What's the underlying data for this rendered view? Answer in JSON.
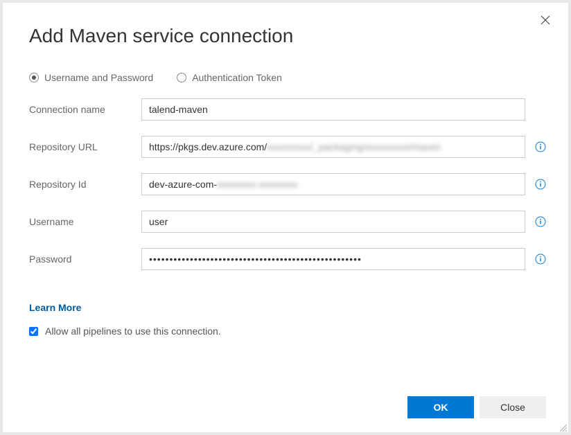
{
  "dialog": {
    "title": "Add Maven service connection",
    "close_tooltip": "Close"
  },
  "auth_method": {
    "options": [
      {
        "label": "Username and Password",
        "selected": true
      },
      {
        "label": "Authentication Token",
        "selected": false
      }
    ]
  },
  "fields": {
    "connection_name": {
      "label": "Connection name",
      "value": "talend-maven"
    },
    "repository_url": {
      "label": "Repository URL",
      "value": "https://pkgs.dev.azure.com/",
      "redacted_suffix": "xxxxxxxxx/_packaging/xxxxxxxxx/maven"
    },
    "repository_id": {
      "label": "Repository Id",
      "value": "dev-azure-com-",
      "redacted_suffix": "xxxxxxxx-xxxxxxxx"
    },
    "username": {
      "label": "Username",
      "value": "user"
    },
    "password": {
      "label": "Password",
      "value": "••••••••••••••••••••••••••••••••••••••••••••••••••••"
    }
  },
  "learn_more": {
    "label": "Learn More"
  },
  "allow_all": {
    "label": "Allow all pipelines to use this connection.",
    "checked": true
  },
  "buttons": {
    "ok": "OK",
    "close": "Close"
  }
}
